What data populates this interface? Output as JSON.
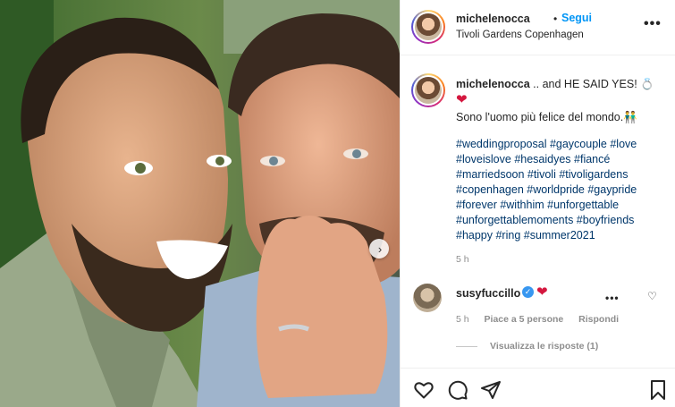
{
  "post": {
    "username": "michelenocca",
    "follow_label": "Segui",
    "location": "Tivoli Gardens Copenhagen",
    "caption_text": ".. and HE SAID YES! 💍",
    "caption_line2": "Sono l'uomo più felice del mondo.👬",
    "hashtag_lines": [
      "#weddingproposal #gaycouple #love",
      "#loveislove #hesaidyes #fiancé",
      "#marriedsoon #tivoli #tivoligardens",
      "#copenhagen #worldpride #gaypride",
      "#forever #withhim #unforgettable",
      "#unforgettablemoments #boyfriends",
      "#happy #ring #summer2021"
    ],
    "time": "5 h",
    "heart_emoji": "❤",
    "more_dots": "•••"
  },
  "comment": {
    "username": "susyfuccillo",
    "verified_mark": "✓",
    "heart_emoji": "❤",
    "time": "5 h",
    "likes": "Piace a 5 persone",
    "reply_label": "Rispondi",
    "view_replies": "Visualizza le risposte (1)",
    "more_dots": "•••",
    "like_icon_glyph": "♡"
  },
  "photo": {
    "next_glyph": "›"
  },
  "colors": {
    "accent": "#0095f6",
    "hashtag": "#00376b",
    "heart": "#d4173f",
    "muted": "#8e8e8e"
  },
  "icons": [
    "more-icon",
    "heart-icon",
    "comment-icon",
    "share-icon",
    "bookmark-icon",
    "verified-icon",
    "next-arrow-icon"
  ]
}
